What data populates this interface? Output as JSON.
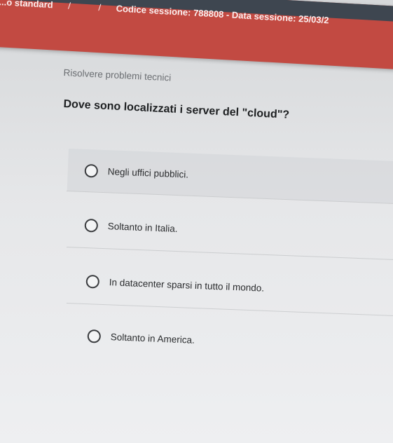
{
  "header": {
    "breadcrumb_start": "...o standard",
    "separator": "/",
    "session_info": "Codice sessione: 788808 - Data sessione: 25/03/2"
  },
  "section": {
    "title": "Risolvere problemi tecnici"
  },
  "question": {
    "text": "Dove sono localizzati i server del \"cloud\"?"
  },
  "options": [
    {
      "label": "Negli uffici pubblici."
    },
    {
      "label": "Soltanto in Italia."
    },
    {
      "label": "In datacenter sparsi in tutto il mondo."
    },
    {
      "label": "Soltanto in America."
    }
  ],
  "colors": {
    "header_bar": "#c24a42",
    "header_dark": "#3e4650",
    "background": "#e6e7e9",
    "question_text": "#1e2022"
  }
}
